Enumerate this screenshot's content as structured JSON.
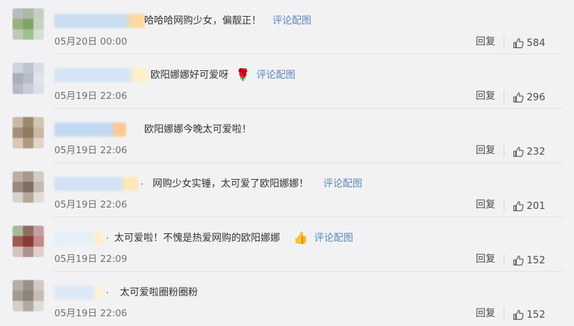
{
  "comments": [
    {
      "text": "哈哈哈网购少女，偏靓正！",
      "image_link": "评论配图",
      "emoji": "",
      "time": "05月20日 00:00",
      "reply": "回复",
      "likes": "584",
      "avatar_colors": [
        "#b6bcc0",
        "#aab9a8",
        "#c7cfc2",
        "#9ab07e",
        "#7fa36c",
        "#c9d3c0",
        "#bfc9b4",
        "#9fc08f",
        "#d7ddd0"
      ],
      "name_colors": [
        "#c9dcf0",
        "#ffd8a0"
      ]
    },
    {
      "text": "欧阳娜娜好可爱呀",
      "image_link": "评论配图",
      "emoji": "🌹",
      "time": "05月19日 22:06",
      "reply": "回复",
      "likes": "296",
      "avatar_colors": [
        "#cfd3dc",
        "#bfc4d0",
        "#d8dce4",
        "#a9aebc",
        "#b7bcc8",
        "#e1e3ea",
        "#b6bbc6",
        "#c9ccd6",
        "#dcdfe6"
      ],
      "name_colors": [
        "#d6e4f5",
        "#fff0c8"
      ]
    },
    {
      "text": "欧阳娜娜今晚太可爱啦！",
      "image_link": "",
      "emoji": "",
      "time": "05月19日 22:06",
      "reply": "回复",
      "likes": "232",
      "avatar_colors": [
        "#c8b8a6",
        "#9c8a6e",
        "#d3c4b3",
        "#a58f78",
        "#8f7a62",
        "#cbb8a2",
        "#d8c8b8",
        "#b09a82",
        "#e0d4c8"
      ],
      "name_colors": [
        "#c2d8f0",
        "#ffc890"
      ]
    },
    {
      "text": "网购少女实锤，太可爱了欧阳娜娜！",
      "image_link": "评论配图",
      "emoji": "",
      "time": "05月19日 22:06",
      "reply": "回复",
      "likes": "201",
      "avatar_colors": [
        "#b8b0a8",
        "#a8988a",
        "#d2ccc6",
        "#9a8a7c",
        "#7e6e62",
        "#c4bab0",
        "#d8d2cc",
        "#b4a89c",
        "#e2dcd6"
      ],
      "name_colors": [
        "#d2e2f4",
        "#ffe8b8"
      ]
    },
    {
      "text": "太可爱啦！不愧是热爱网购的欧阳娜娜",
      "image_link": "评论配图",
      "emoji": "👍",
      "time": "05月19日 22:09",
      "reply": "回复",
      "likes": "152",
      "avatar_colors": [
        "#a9b89a",
        "#8c6e5e",
        "#c4a0a0",
        "#9e5a4e",
        "#8a3a36",
        "#c48a86",
        "#d6c2be",
        "#b09090",
        "#e0cfcc"
      ],
      "name_colors": [
        "#e6eef8",
        "#ffeecc"
      ]
    },
    {
      "text": "太可爱啦圈粉圈粉",
      "image_link": "",
      "emoji": "",
      "time": "05月19日 22:06",
      "reply": "回复",
      "likes": "152",
      "avatar_colors": [
        "#b4aea8",
        "#9a928a",
        "#cfcac4",
        "#a39a90",
        "#8e8479",
        "#c6beb6",
        "#d4cfca",
        "#b2aaa2",
        "#e0dcd8"
      ],
      "name_colors": [
        "#dde8f6",
        "#fff2d4"
      ]
    }
  ],
  "colors": {
    "background": "#f2f2f5",
    "link": "#5c87b8",
    "text": "#333333",
    "meta": "#6f6f6f"
  }
}
